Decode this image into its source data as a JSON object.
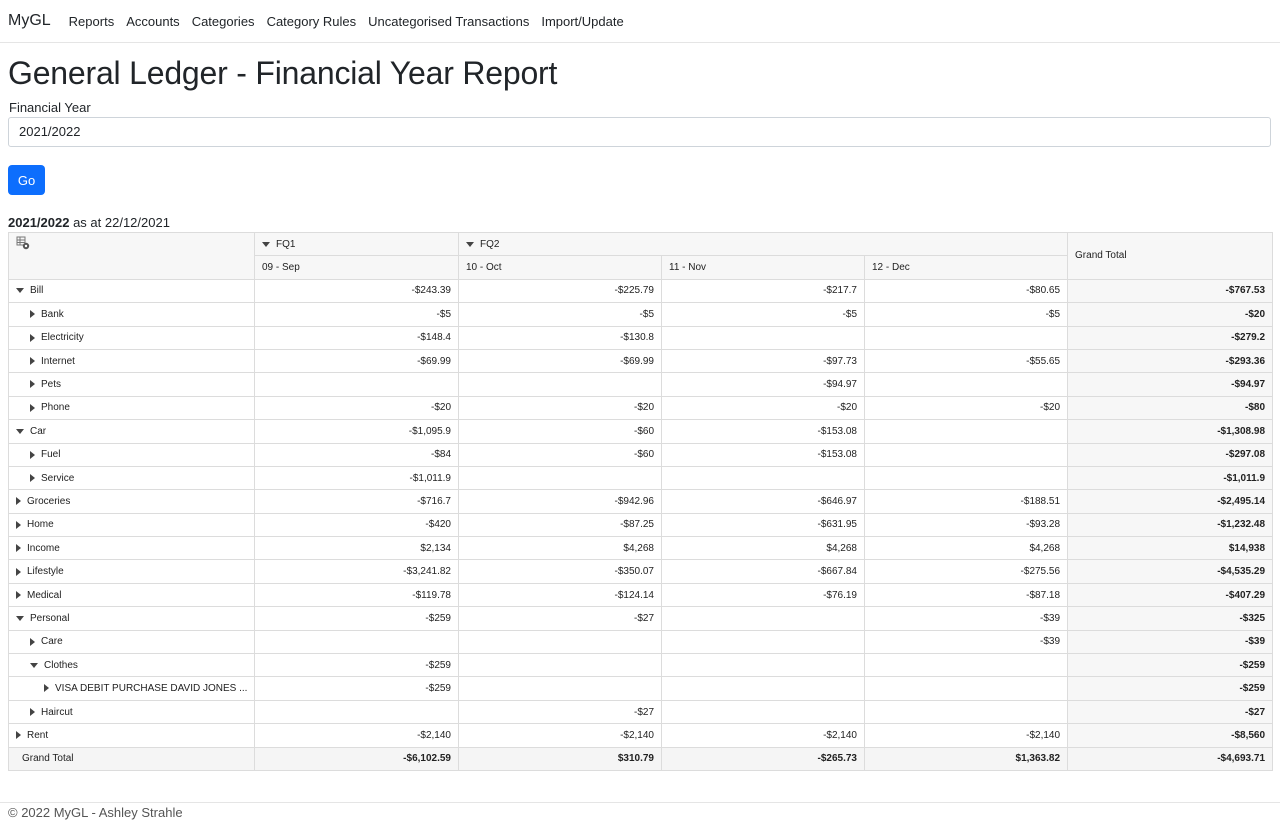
{
  "nav": {
    "brand": "MyGL",
    "links": [
      "Reports",
      "Accounts",
      "Categories",
      "Category Rules",
      "Uncategorised Transactions",
      "Import/Update"
    ]
  },
  "page_title": "General Ledger - Financial Year Report",
  "form": {
    "label": "Financial Year",
    "selected": "2021/2022",
    "button": "Go"
  },
  "report": {
    "year": "2021/2022",
    "as_at": "as at 22/12/2021"
  },
  "pivot": {
    "fields_icon": "pivot-field-list-icon",
    "quarters": [
      "FQ1",
      "FQ2"
    ],
    "months": [
      "09 - Sep",
      "10 - Oct",
      "11 - Nov",
      "12 - Dec"
    ],
    "grand_total_header": "Grand Total",
    "rows": [
      {
        "label": "Bill",
        "level": 0,
        "state": "expanded",
        "cells": [
          "-$243.39",
          "-$225.79",
          "-$217.7",
          "-$80.65"
        ],
        "total": "-$767.53"
      },
      {
        "label": "Bank",
        "level": 1,
        "state": "collapsed",
        "cells": [
          "-$5",
          "-$5",
          "-$5",
          "-$5"
        ],
        "total": "-$20"
      },
      {
        "label": "Electricity",
        "level": 1,
        "state": "collapsed",
        "cells": [
          "-$148.4",
          "-$130.8",
          "",
          ""
        ],
        "total": "-$279.2"
      },
      {
        "label": "Internet",
        "level": 1,
        "state": "collapsed",
        "cells": [
          "-$69.99",
          "-$69.99",
          "-$97.73",
          "-$55.65"
        ],
        "total": "-$293.36"
      },
      {
        "label": "Pets",
        "level": 1,
        "state": "collapsed",
        "cells": [
          "",
          "",
          "-$94.97",
          ""
        ],
        "total": "-$94.97"
      },
      {
        "label": "Phone",
        "level": 1,
        "state": "collapsed",
        "cells": [
          "-$20",
          "-$20",
          "-$20",
          "-$20"
        ],
        "total": "-$80"
      },
      {
        "label": "Car",
        "level": 0,
        "state": "expanded",
        "cells": [
          "-$1,095.9",
          "-$60",
          "-$153.08",
          ""
        ],
        "total": "-$1,308.98"
      },
      {
        "label": "Fuel",
        "level": 1,
        "state": "collapsed",
        "cells": [
          "-$84",
          "-$60",
          "-$153.08",
          ""
        ],
        "total": "-$297.08"
      },
      {
        "label": "Service",
        "level": 1,
        "state": "collapsed",
        "cells": [
          "-$1,011.9",
          "",
          "",
          ""
        ],
        "total": "-$1,011.9"
      },
      {
        "label": "Groceries",
        "level": 0,
        "state": "collapsed",
        "cells": [
          "-$716.7",
          "-$942.96",
          "-$646.97",
          "-$188.51"
        ],
        "total": "-$2,495.14"
      },
      {
        "label": "Home",
        "level": 0,
        "state": "collapsed",
        "cells": [
          "-$420",
          "-$87.25",
          "-$631.95",
          "-$93.28"
        ],
        "total": "-$1,232.48"
      },
      {
        "label": "Income",
        "level": 0,
        "state": "collapsed",
        "cells": [
          "$2,134",
          "$4,268",
          "$4,268",
          "$4,268"
        ],
        "total": "$14,938"
      },
      {
        "label": "Lifestyle",
        "level": 0,
        "state": "collapsed",
        "cells": [
          "-$3,241.82",
          "-$350.07",
          "-$667.84",
          "-$275.56"
        ],
        "total": "-$4,535.29"
      },
      {
        "label": "Medical",
        "level": 0,
        "state": "collapsed",
        "cells": [
          "-$119.78",
          "-$124.14",
          "-$76.19",
          "-$87.18"
        ],
        "total": "-$407.29"
      },
      {
        "label": "Personal",
        "level": 0,
        "state": "expanded",
        "cells": [
          "-$259",
          "-$27",
          "",
          "-$39"
        ],
        "total": "-$325"
      },
      {
        "label": "Care",
        "level": 1,
        "state": "collapsed",
        "cells": [
          "",
          "",
          "",
          "-$39"
        ],
        "total": "-$39"
      },
      {
        "label": "Clothes",
        "level": 1,
        "state": "expanded",
        "cells": [
          "-$259",
          "",
          "",
          ""
        ],
        "total": "-$259"
      },
      {
        "label": "VISA DEBIT PURCHASE DAVID JONES ...",
        "level": 2,
        "state": "collapsed",
        "cells": [
          "-$259",
          "",
          "",
          ""
        ],
        "total": "-$259"
      },
      {
        "label": "Haircut",
        "level": 1,
        "state": "collapsed",
        "cells": [
          "",
          "-$27",
          "",
          ""
        ],
        "total": "-$27"
      },
      {
        "label": "Rent",
        "level": 0,
        "state": "collapsed",
        "cells": [
          "-$2,140",
          "-$2,140",
          "-$2,140",
          "-$2,140"
        ],
        "total": "-$8,560"
      }
    ],
    "grand_total": {
      "label": "Grand Total",
      "cells": [
        "-$6,102.59",
        "$310.79",
        "-$265.73",
        "$1,363.82"
      ],
      "total": "-$4,693.71"
    }
  },
  "footer": "© 2022 MyGL - Ashley Strahle"
}
